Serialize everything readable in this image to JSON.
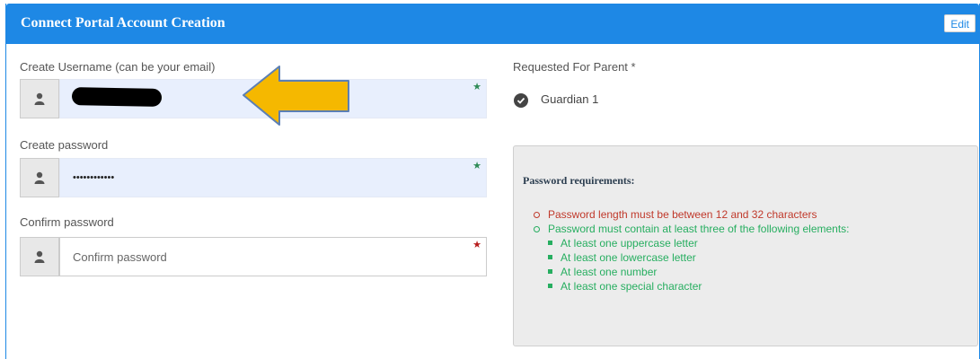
{
  "header": {
    "title": "Connect Portal Account Creation",
    "edit_label": "Edit",
    "color": "#1e88e5"
  },
  "username": {
    "label": "Create Username (can be your email)",
    "value": "",
    "icon": "user-icon",
    "required_status": "valid"
  },
  "password": {
    "label": "Create password",
    "value": "••••••••••••",
    "icon": "user-icon",
    "required_status": "valid"
  },
  "confirm_password": {
    "label": "Confirm password",
    "value": "",
    "placeholder": "Confirm password",
    "icon": "user-icon",
    "required_status": "invalid"
  },
  "requested_for": {
    "label": "Requested For Parent *",
    "selected": "Guardian 1",
    "icon": "check-circle-icon"
  },
  "requirements": {
    "title": "Password requirements:",
    "items": [
      {
        "text": "Password length must be between 12 and 32 characters",
        "status": "unmet"
      },
      {
        "text": "Password must contain at least three of the following elements:",
        "status": "met"
      }
    ],
    "sub_items": [
      "At least one uppercase letter",
      "At least one lowercase letter",
      "At least one number",
      "At least one special character"
    ]
  },
  "colors": {
    "valid": "#27ae60",
    "invalid": "#c0392b",
    "arrow_fill": "#f5b800",
    "arrow_stroke": "#5b7fb5"
  }
}
